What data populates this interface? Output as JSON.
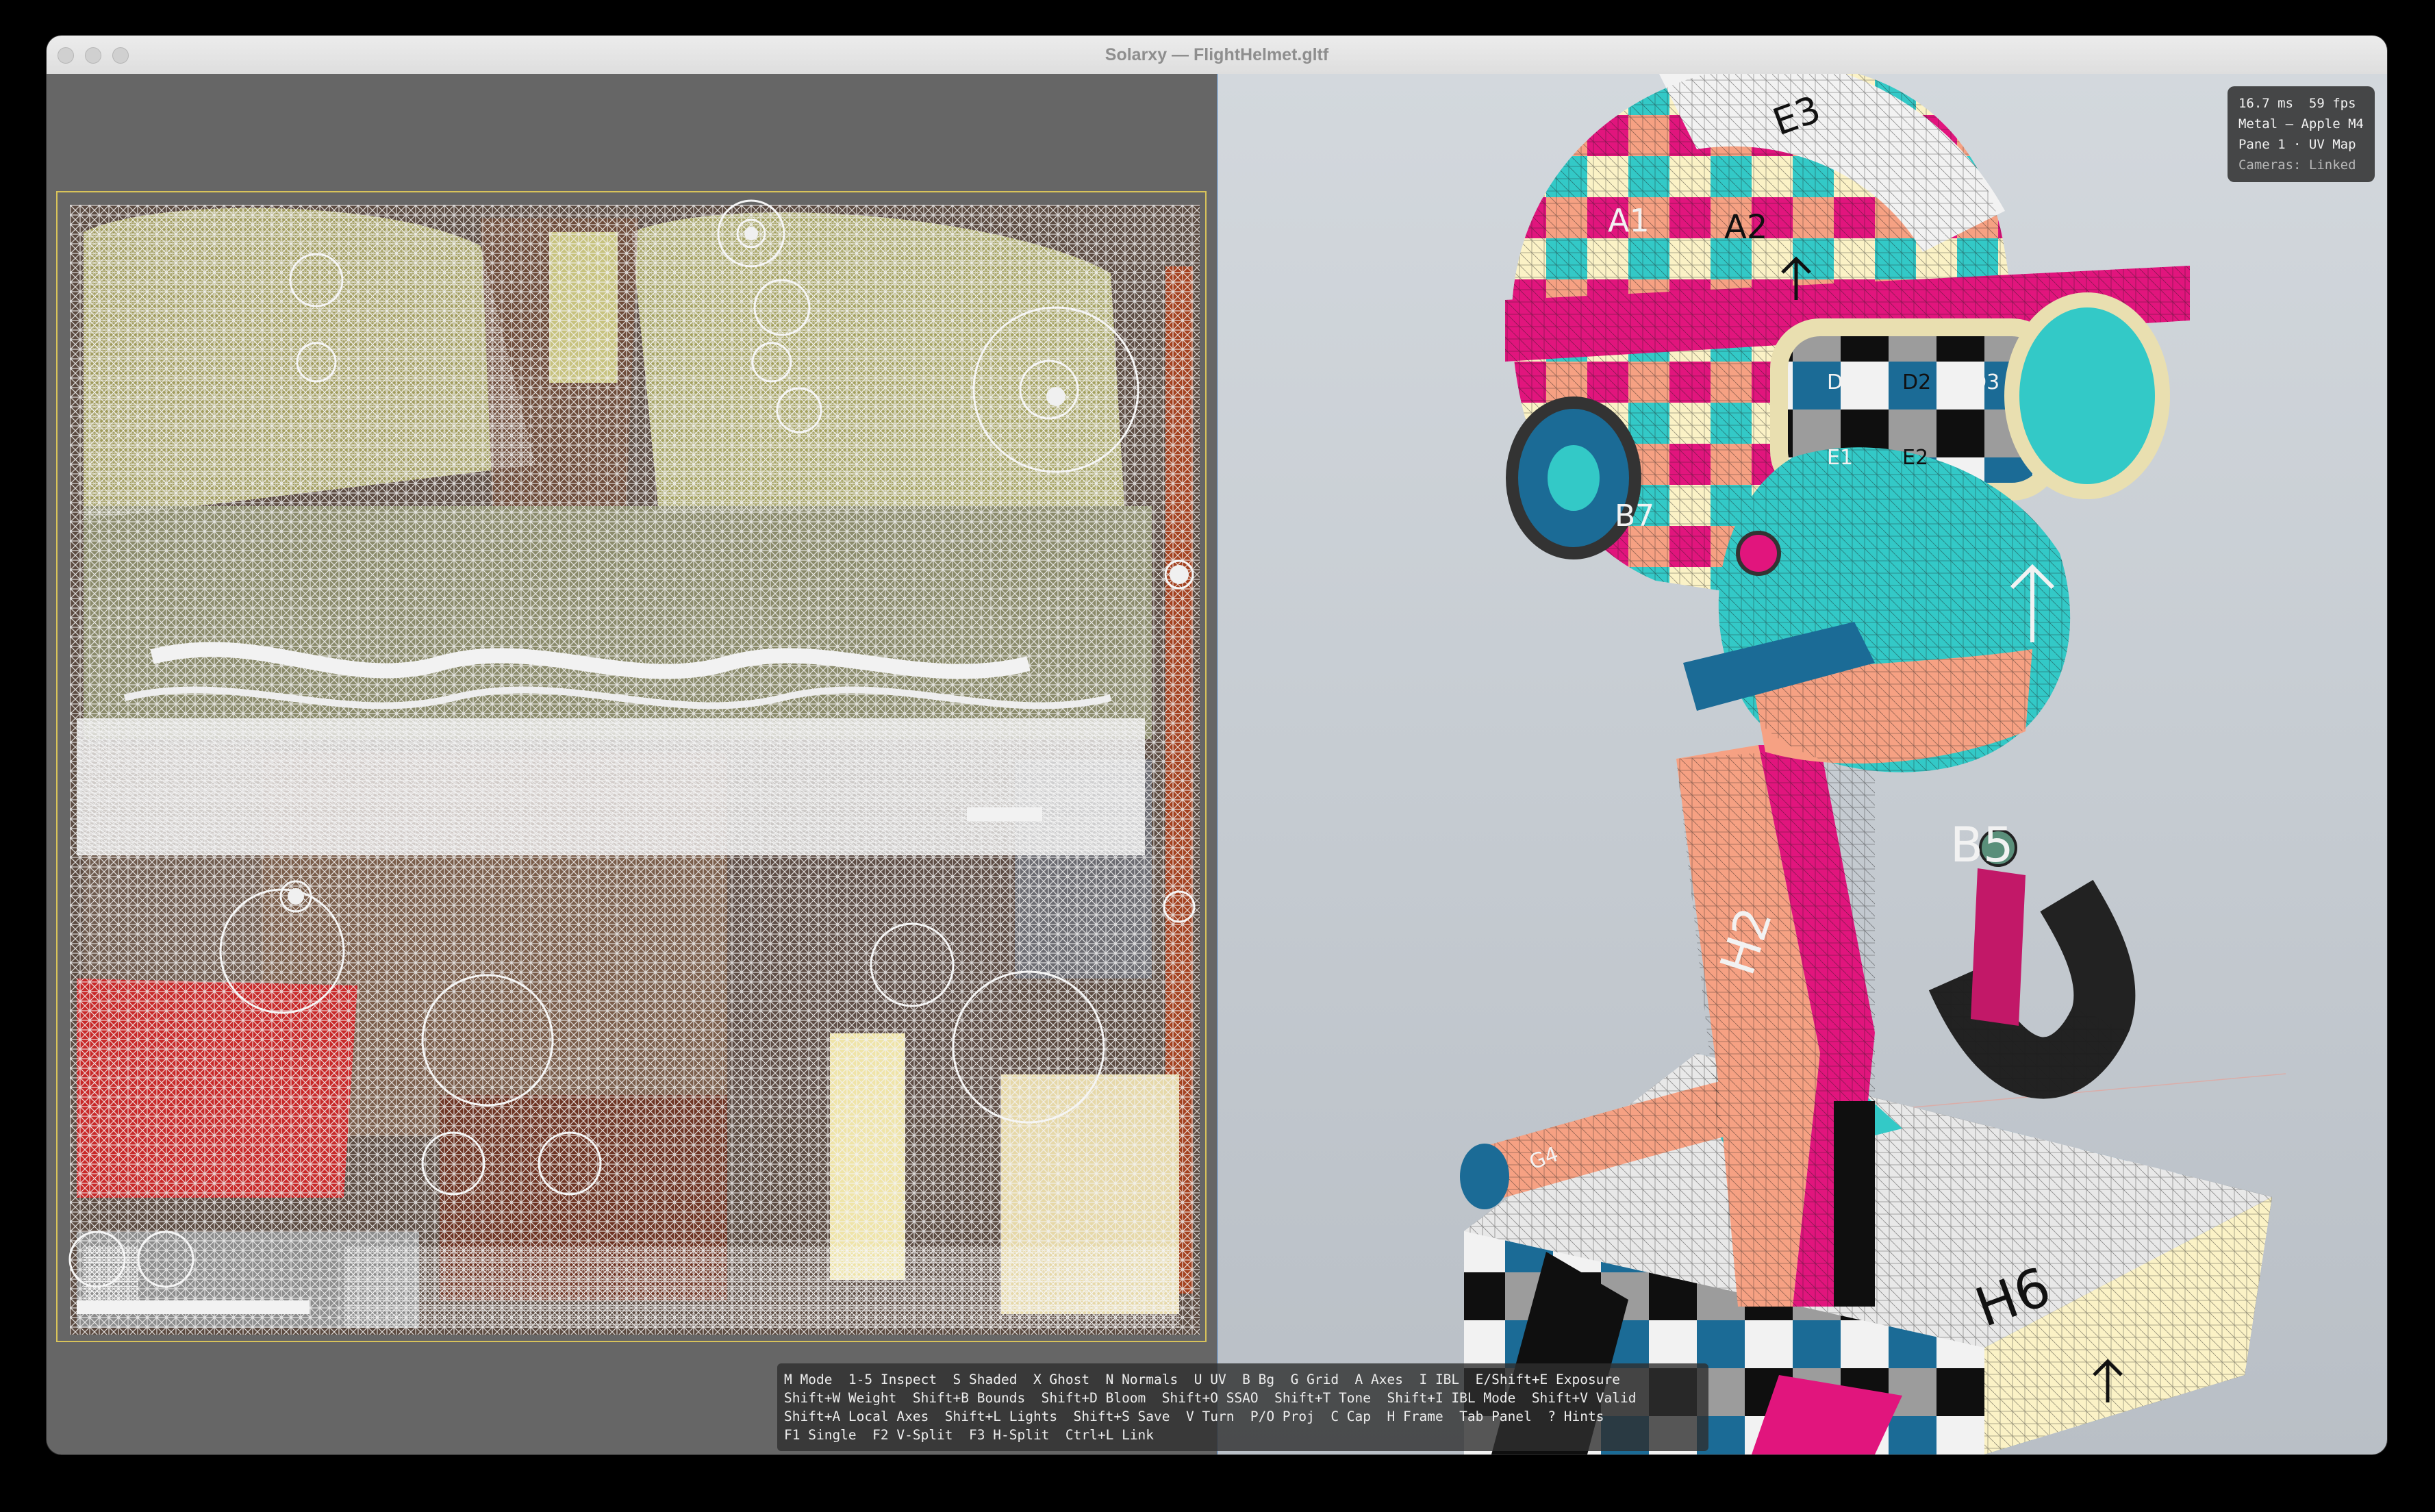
{
  "window": {
    "title": "Solarxy — FlightHelmet.gltf",
    "controls": [
      "close",
      "minimize",
      "zoom"
    ]
  },
  "uv_pane": {
    "label": "UV Map",
    "background": "#666666",
    "bounds_color": "#d8c35a",
    "wire_color": "#f4f4f4"
  },
  "model_pane": {
    "background": "#c9ced4",
    "axis_line_color": "#e6a39a",
    "uv_checker_colors": [
      "#e1157d",
      "#33c9c7",
      "#fbf2c6",
      "#f6a183",
      "#1b6b96",
      "#0f0f0f",
      "#9c9c9c",
      "#f2f2f2"
    ],
    "checker_labels": [
      "E3",
      "A1",
      "A2",
      "D1",
      "D2",
      "D3",
      "E1",
      "E2",
      "B7",
      "B5",
      "H2",
      "H6",
      "G4"
    ]
  },
  "stats": {
    "line1": "16.7 ms  59 fps",
    "line2": "Metal — Apple M4",
    "line3": "Pane 1 · UV Map",
    "line4": "Cameras: Linked"
  },
  "hints": {
    "line1": "M Mode  1-5 Inspect  S Shaded  X Ghost  N Normals  U UV  B Bg  G Grid  A Axes  I IBL  E/Shift+E Exposure",
    "line2": "Shift+W Weight  Shift+B Bounds  Shift+D Bloom  Shift+O SSAO  Shift+T Tone  Shift+I IBL Mode  Shift+V Valid",
    "line3": "Shift+A Local Axes  Shift+L Lights  Shift+S Save  V Turn  P/O Proj  C Cap  H Frame  Tab Panel  ? Hints",
    "line4": "F1 Single  F2 V-Split  F3 H-Split  Ctrl+L Link"
  }
}
